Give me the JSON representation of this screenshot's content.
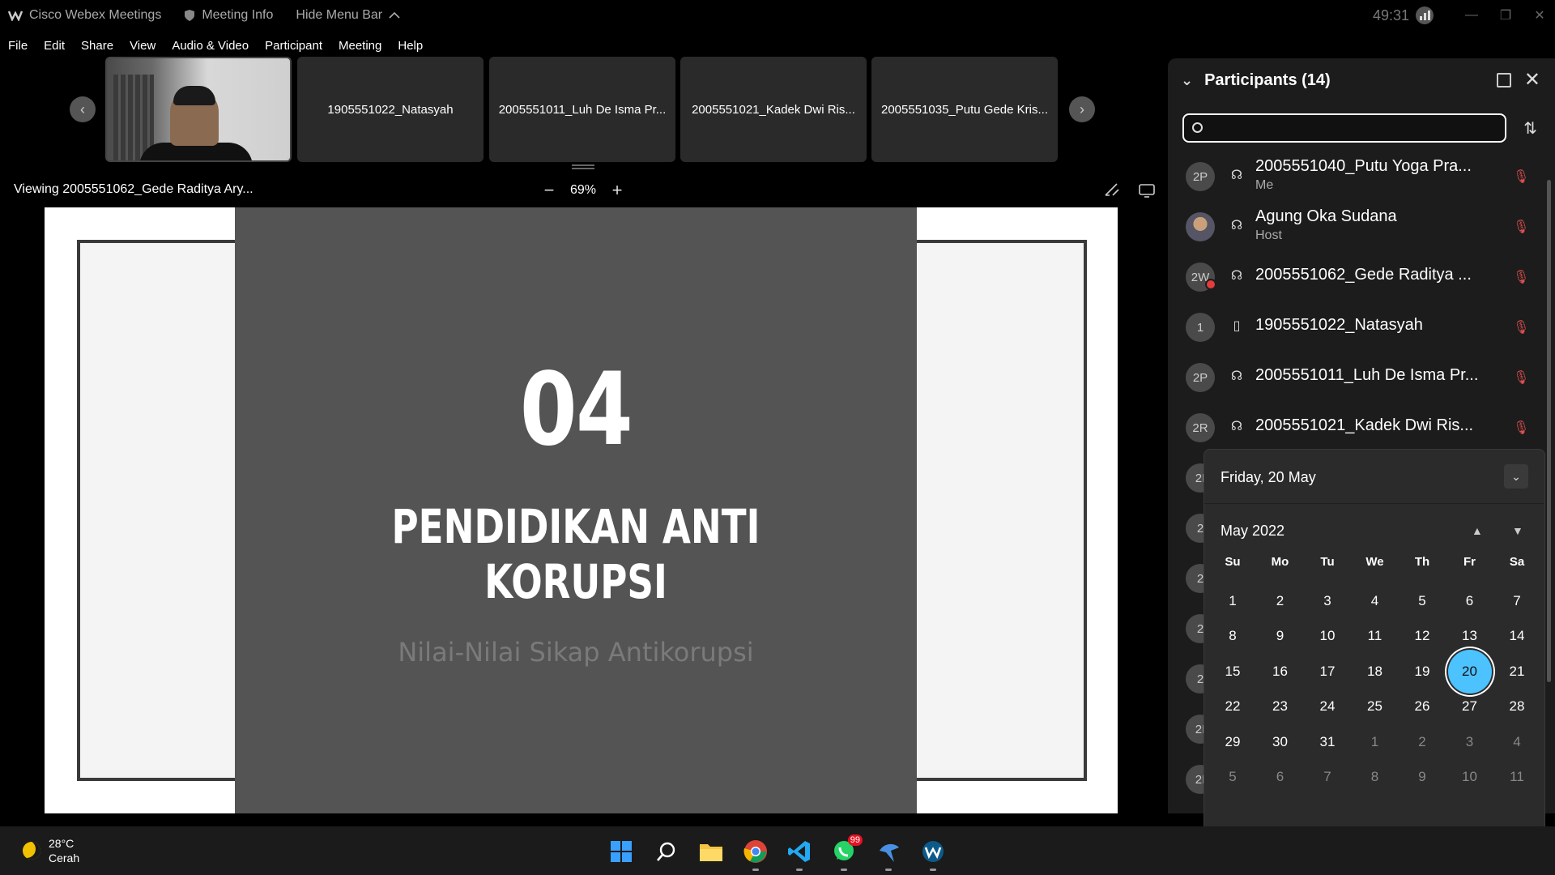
{
  "titlebar": {
    "app_name": "Cisco Webex Meetings",
    "meeting_info": "Meeting Info",
    "hide_menu": "Hide Menu Bar",
    "timer": "49:31"
  },
  "menu": [
    "File",
    "Edit",
    "Share",
    "View",
    "Audio & Video",
    "Participant",
    "Meeting",
    "Help"
  ],
  "video_tiles": [
    "1905551022_Natasyah",
    "2005551011_Luh De Isma Pr...",
    "2005551021_Kadek Dwi Ris...",
    "2005551035_Putu Gede Kris..."
  ],
  "viewing": {
    "label": "Viewing 2005551062_Gede Raditya Ary...",
    "zoom": "69%",
    "zoom_out": "−",
    "zoom_in": "+"
  },
  "slide": {
    "number": "04",
    "title": "PENDIDIKAN ANTI KORUPSI",
    "subtitle": "Nilai-Nilai Sikap Antikorupsi"
  },
  "participants": {
    "title": "Participants (14)",
    "rows": [
      {
        "initials": "2P",
        "name": "2005551040_Putu Yoga Pra...",
        "role": "Me"
      },
      {
        "initials": "",
        "name": "Agung Oka Sudana",
        "role": "Host"
      },
      {
        "initials": "2W",
        "name": "2005551062_Gede Raditya ...",
        "role": ""
      },
      {
        "initials": "1",
        "name": "1905551022_Natasyah",
        "role": ""
      },
      {
        "initials": "2P",
        "name": "2005551011_Luh De Isma Pr...",
        "role": ""
      },
      {
        "initials": "2R",
        "name": "2005551021_Kadek Dwi Ris...",
        "role": ""
      }
    ],
    "hidden_initials": [
      "2I",
      "2",
      "2",
      "2",
      "2",
      "2I",
      "2I"
    ]
  },
  "calendar": {
    "selected_date_label": "Friday, 20 May",
    "month_label": "May 2022",
    "weekdays": [
      "Su",
      "Mo",
      "Tu",
      "We",
      "Th",
      "Fr",
      "Sa"
    ],
    "weeks": [
      [
        "1",
        "2",
        "3",
        "4",
        "5",
        "6",
        "7"
      ],
      [
        "8",
        "9",
        "10",
        "11",
        "12",
        "13",
        "14"
      ],
      [
        "15",
        "16",
        "17",
        "18",
        "19",
        "20",
        "21"
      ],
      [
        "22",
        "23",
        "24",
        "25",
        "26",
        "27",
        "28"
      ],
      [
        "29",
        "30",
        "31",
        "1",
        "2",
        "3",
        "4"
      ],
      [
        "5",
        "6",
        "7",
        "8",
        "9",
        "10",
        "11"
      ]
    ],
    "selected_day": "20",
    "accent_color": "#4cc2ff"
  },
  "taskbar": {
    "temperature": "28°C",
    "condition": "Cerah",
    "whatsapp_badge": "99"
  }
}
